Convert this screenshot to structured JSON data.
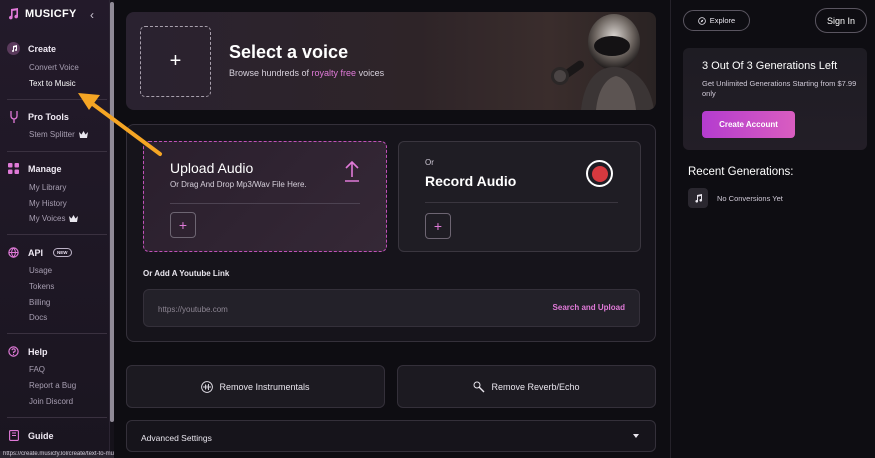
{
  "app": {
    "name": "MUSICFY"
  },
  "sidebar": {
    "create": {
      "label": "Create",
      "items": [
        "Convert Voice",
        "Text to Music"
      ]
    },
    "pro_tools": {
      "label": "Pro Tools",
      "items": [
        "Stem Splitter"
      ]
    },
    "manage": {
      "label": "Manage",
      "items": [
        "My Library",
        "My History",
        "My Voices"
      ]
    },
    "api": {
      "label": "API",
      "badge": "NEW",
      "items": [
        "Usage",
        "Tokens",
        "Billing",
        "Docs"
      ]
    },
    "help": {
      "label": "Help",
      "items": [
        "FAQ",
        "Report a Bug",
        "Join Discord"
      ]
    },
    "guide": {
      "label": "Guide"
    },
    "status_url": "https://create.musicfy.lol/create/text-to-music"
  },
  "hero": {
    "title": "Select a voice",
    "subtitle_pre": "Browse hundreds of ",
    "subtitle_highlight": "royalty free",
    "subtitle_post": " voices"
  },
  "upload": {
    "title": "Upload Audio",
    "subtitle": "Or Drag And Drop Mp3/Wav File Here."
  },
  "record": {
    "or": "Or",
    "title": "Record Audio"
  },
  "youtube": {
    "label": "Or Add A Youtube Link",
    "placeholder": "https://youtube.com",
    "action": "Search and Upload"
  },
  "actions": {
    "remove_instrumentals": "Remove Instrumentals",
    "remove_reverb": "Remove Reverb/Echo"
  },
  "advanced": {
    "label": "Advanced Settings"
  },
  "header": {
    "explore": "Explore",
    "sign_in": "Sign In"
  },
  "generations": {
    "title": "3 Out Of 3 Generations Left",
    "subtitle": "Get Unlimited Generations Starting from $7.99 only",
    "cta": "Create Account"
  },
  "recent": {
    "title": "Recent Generations:",
    "empty": "No Conversions Yet"
  },
  "colors": {
    "accent": "#e07ad8",
    "cta": "#c24acb",
    "record": "#d6393f",
    "annotation": "#f5a524"
  }
}
